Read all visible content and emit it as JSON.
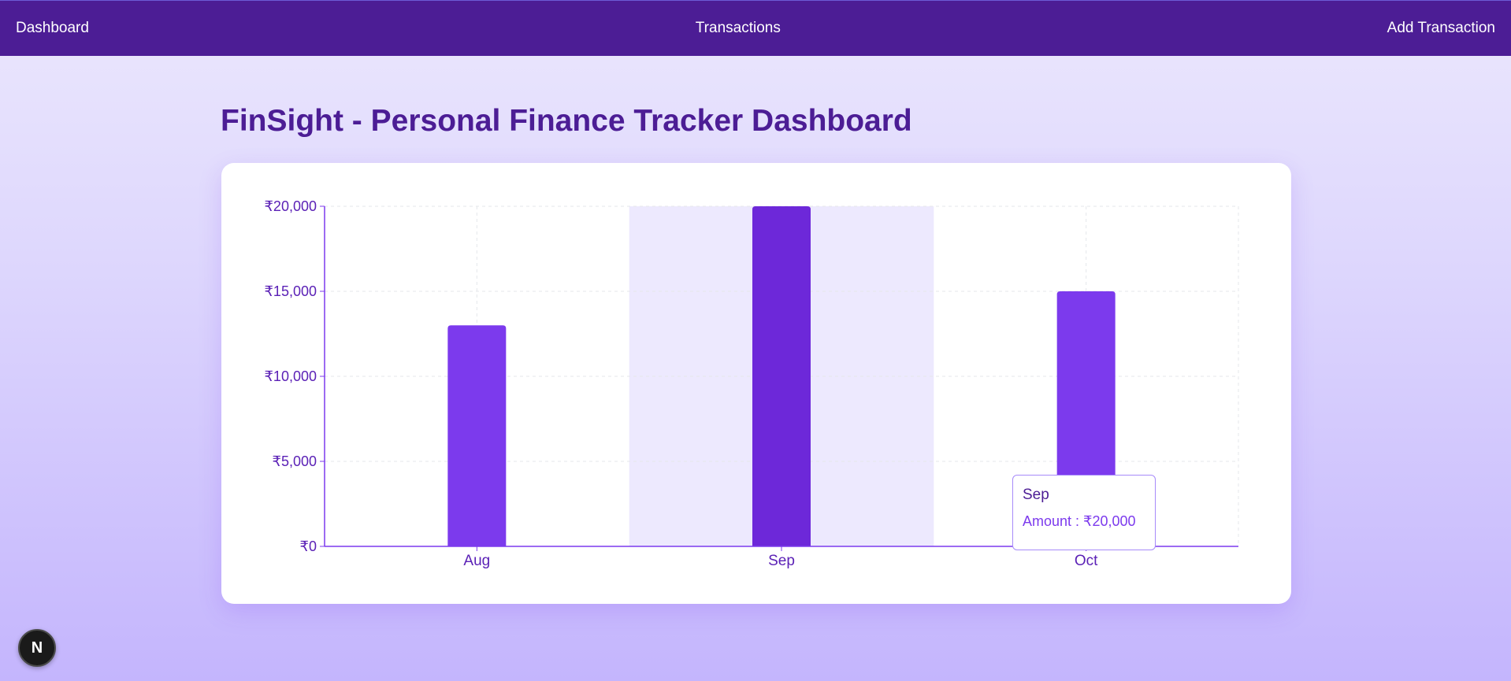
{
  "nav": {
    "dashboard": "Dashboard",
    "transactions": "Transactions",
    "add_transaction": "Add Transaction"
  },
  "page": {
    "title": "FinSight - Personal Finance Tracker Dashboard"
  },
  "chart_data": {
    "type": "bar",
    "categories": [
      "Aug",
      "Sep",
      "Oct"
    ],
    "series": [
      {
        "name": "Amount",
        "values": [
          13000,
          20000,
          15000
        ]
      }
    ],
    "ylim": [
      0,
      20000
    ],
    "yticks": [
      0,
      5000,
      10000,
      15000,
      20000
    ],
    "ytick_labels": [
      "₹0",
      "₹5,000",
      "₹10,000",
      "₹15,000",
      "₹20,000"
    ],
    "grid": true,
    "legend": "none",
    "highlighted_category": "Sep",
    "colors": {
      "bar": "#7c3aed",
      "bar_active": "#6d28d9",
      "highlight_band": "#ede9fe",
      "axis": "#7c3aed",
      "tick_text": "#5b21b6",
      "grid": "#e5e7eb"
    }
  },
  "tooltip": {
    "label": "Sep",
    "value": "Amount : ₹20,000"
  },
  "badge": {
    "letter": "N"
  },
  "colors": {
    "navbar": "#4c1d95",
    "title": "#4c1d95",
    "accent": "#7c3aed"
  }
}
